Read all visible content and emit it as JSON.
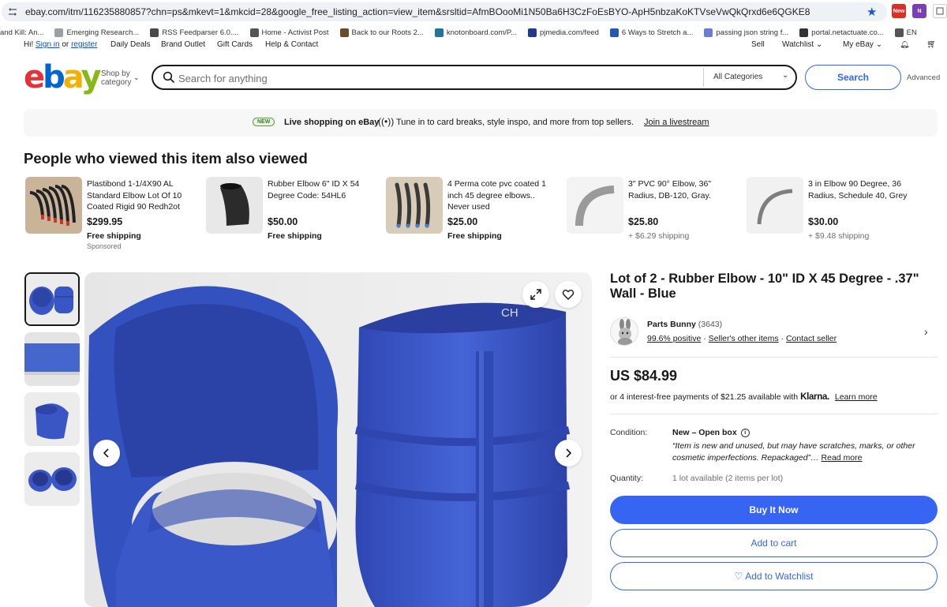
{
  "browser": {
    "url": "ebay.com/itm/116235880857?chn=ps&mkevt=1&mkcid=28&google_free_listing_action=view_item&srsltid=AfmBOooMi1N50Ba6H3CzFoEsBYO-ApH5nbzaKoKTVseVwQkQrxd6e6QGKE8",
    "ext_new_label": "New",
    "bookmarks": [
      {
        "label": "and Kill: An...",
        "icon": "none",
        "color": "#ffffff"
      },
      {
        "label": "Emerging Research...",
        "icon": "plus-icon",
        "color": "#9aa0a6"
      },
      {
        "label": "RSS Feedparser 6.0....",
        "icon": "rss-icon",
        "color": "#4a4a4a"
      },
      {
        "label": "Home - Activist Post",
        "icon": "globe-icon",
        "color": "#555555"
      },
      {
        "label": "Back to our Roots 2...",
        "icon": "site-icon",
        "color": "#6b4a2a"
      },
      {
        "label": "knotonboard.com/P...",
        "icon": "wordpress-icon",
        "color": "#21759b"
      },
      {
        "label": "pjmedia.com/feed",
        "icon": "pj-icon",
        "color": "#1f3b8c"
      },
      {
        "label": "6 Ways to Stretch a...",
        "icon": "site-icon",
        "color": "#2458b3"
      },
      {
        "label": "passing json string f...",
        "icon": "ps-icon",
        "color": "#6c7cd6"
      },
      {
        "label": "portal.netactuate.co...",
        "icon": "portal-icon",
        "color": "#333333"
      },
      {
        "label": "EN",
        "icon": "globe-icon",
        "color": "#555555"
      }
    ]
  },
  "topnav": {
    "greeting_prefix": "Hi!",
    "sign_in": "Sign in",
    "or": "or",
    "register": "register",
    "links": [
      "Daily Deals",
      "Brand Outlet",
      "Gift Cards",
      "Help & Contact"
    ],
    "sell": "Sell",
    "watchlist": "Watchlist",
    "my_ebay": "My eBay"
  },
  "header": {
    "logo": {
      "e": "e",
      "b": "b",
      "a": "a",
      "y": "y"
    },
    "shop_by_line1": "Shop by",
    "shop_by_line2": "category",
    "search_placeholder": "Search for anything",
    "category_value": "All Categories",
    "search_button": "Search",
    "advanced": "Advanced"
  },
  "banner": {
    "badge": "NEW",
    "title": "Live shopping on eBay",
    "text": "Tune in to card breaks, style inspo, and more from top sellers.",
    "link": "Join a livestream"
  },
  "also_viewed": {
    "title": "People who viewed this item also viewed",
    "items": [
      {
        "title": "Plastibond 1-1/4X90 AL Standard Elbow Lot Of 10 Coated Rigid 90 Redh2ot",
        "price": "$299.95",
        "shipping": "Free shipping",
        "sponsored": "Sponsored"
      },
      {
        "title": "Rubber Elbow 6\" ID X 54 Degree Code: 54HL6",
        "price": "$50.00",
        "shipping": "Free shipping",
        "sponsored": ""
      },
      {
        "title": "4 Perma cote pvc coated 1 inch 45 degree elbows.. Never used",
        "price": "$25.00",
        "shipping": "Free shipping",
        "sponsored": ""
      },
      {
        "title": "3\" PVC 90° Elbow, 36\" Radius, DB-120, Gray.",
        "price": "$25.80",
        "shipping": "+ $6.29 shipping",
        "sponsored": ""
      },
      {
        "title": "3 in Elbow 90 Degree, 36 Radius, Schedule 40, Grey",
        "price": "$30.00",
        "shipping": "+ $9.48 shipping",
        "sponsored": ""
      }
    ]
  },
  "item": {
    "title": "Lot of 2 - Rubber Elbow - 10\" ID X 45 Degree - .37\" Wall - Blue",
    "seller_name": "Parts Bunny",
    "seller_count": "(3643)",
    "seller_positive": "99.6% positive",
    "seller_other": "Seller's other items",
    "contact_seller": "Contact seller",
    "price": "US $84.99",
    "installments": "or 4 interest-free payments of $21.25 available with",
    "klarna": "Klarna.",
    "learn_more": "Learn more",
    "condition_label": "Condition:",
    "condition_value": "New – Open box",
    "condition_desc": "Item is new and unused, but may have scratches, marks, or other cosmetic imperfections. Repackaged",
    "read_more": "Read more",
    "quantity_label": "Quantity:",
    "quantity_value": "1 lot available (2 items per lot)",
    "buy_now": "Buy It Now",
    "add_cart": "Add to cart",
    "add_watchlist": "Add to Watchlist",
    "image_mark": "CH",
    "accent_color": "#3665f3",
    "product_color": "#3a55c4"
  }
}
